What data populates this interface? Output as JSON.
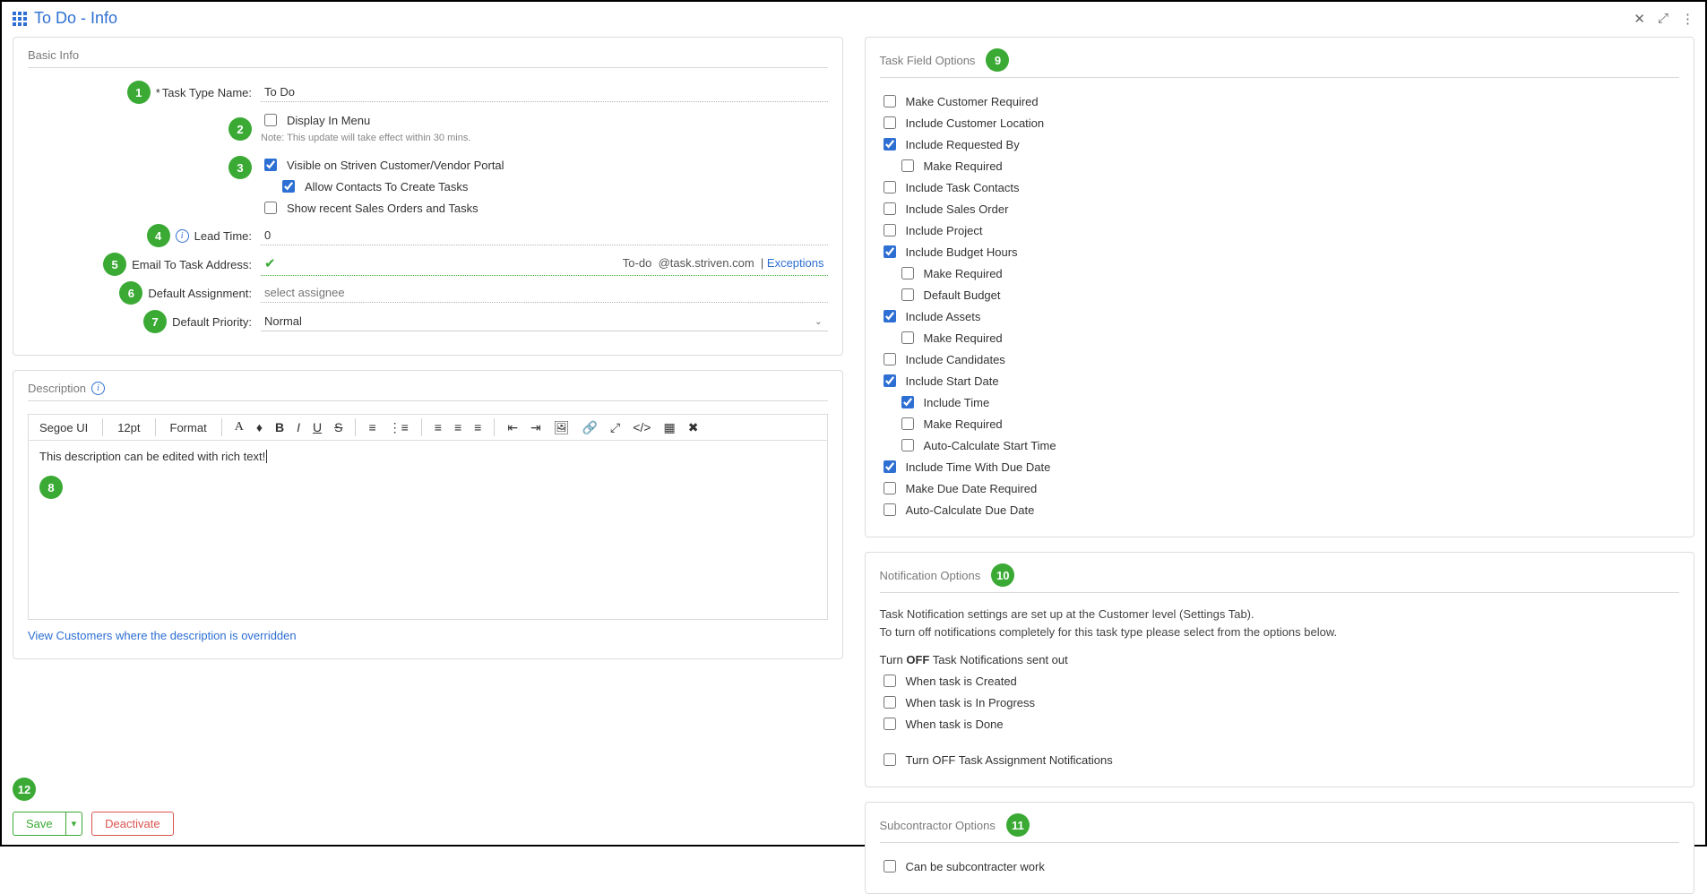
{
  "page": {
    "title": "To Do - Info"
  },
  "basic": {
    "section_title": "Basic Info",
    "task_type_label": "Task Type Name:",
    "task_type_value": "To Do",
    "display_in_menu_label": "Display In Menu",
    "display_note": "Note: This update will take effect within 30 mins.",
    "visible_portal_label": "Visible on Striven Customer/Vendor Portal",
    "allow_contacts_label": "Allow Contacts To Create Tasks",
    "show_recent_label": "Show recent Sales Orders and Tasks",
    "lead_time_label": "Lead Time:",
    "lead_time_value": "0",
    "email_task_label": "Email To Task Address:",
    "email_prefix": "To-do",
    "email_domain": "@task.striven.com",
    "exceptions_link": "Exceptions",
    "default_assignment_label": "Default Assignment:",
    "default_assignment_placeholder": "select assignee",
    "default_priority_label": "Default Priority:",
    "default_priority_value": "Normal"
  },
  "description": {
    "section_title": "Description",
    "toolbar": {
      "font": "Segoe UI",
      "size": "12pt",
      "format": "Format"
    },
    "body": "This description can be edited with rich text!",
    "overridden_link": "View Customers where the description is overridden"
  },
  "task_field_options": {
    "section_title": "Task Field Options",
    "items": [
      {
        "label": "Make Customer Required",
        "checked": false,
        "indent": 0
      },
      {
        "label": "Include Customer Location",
        "checked": false,
        "indent": 0
      },
      {
        "label": "Include Requested By",
        "checked": true,
        "indent": 0
      },
      {
        "label": "Make Required",
        "checked": false,
        "indent": 1
      },
      {
        "label": "Include Task Contacts",
        "checked": false,
        "indent": 0
      },
      {
        "label": "Include Sales Order",
        "checked": false,
        "indent": 0
      },
      {
        "label": "Include Project",
        "checked": false,
        "indent": 0
      },
      {
        "label": "Include Budget Hours",
        "checked": true,
        "indent": 0
      },
      {
        "label": "Make Required",
        "checked": false,
        "indent": 1
      },
      {
        "label": "Default Budget",
        "checked": false,
        "indent": 1
      },
      {
        "label": "Include Assets",
        "checked": true,
        "indent": 0
      },
      {
        "label": "Make Required",
        "checked": false,
        "indent": 1
      },
      {
        "label": "Include Candidates",
        "checked": false,
        "indent": 0
      },
      {
        "label": "Include Start Date",
        "checked": true,
        "indent": 0
      },
      {
        "label": "Include Time",
        "checked": true,
        "indent": 1
      },
      {
        "label": "Make Required",
        "checked": false,
        "indent": 1
      },
      {
        "label": "Auto-Calculate Start Time",
        "checked": false,
        "indent": 1
      },
      {
        "label": "Include Time With Due Date",
        "checked": true,
        "indent": 0
      },
      {
        "label": "Make Due Date Required",
        "checked": false,
        "indent": 0
      },
      {
        "label": "Auto-Calculate Due Date",
        "checked": false,
        "indent": 0
      }
    ]
  },
  "notification_options": {
    "section_title": "Notification Options",
    "desc_line1": "Task Notification settings are set up at the Customer level (Settings Tab).",
    "desc_line2": "To turn off notifications completely for this task type please select from the options below.",
    "turn_off_label_pre": "Turn ",
    "turn_off_label_bold": "OFF",
    "turn_off_label_post": " Task Notifications sent out",
    "created_label": "When task is Created",
    "in_progress_label": "When task is In Progress",
    "done_label": "When task is Done",
    "assignment_label": "Turn OFF Task Assignment Notifications"
  },
  "subcontractor_options": {
    "section_title": "Subcontractor Options",
    "can_be_label": "Can be subcontracter work"
  },
  "footer": {
    "save": "Save",
    "deactivate": "Deactivate"
  },
  "badges": {
    "b1": "1",
    "b2": "2",
    "b3": "3",
    "b4": "4",
    "b5": "5",
    "b6": "6",
    "b7": "7",
    "b8": "8",
    "b9": "9",
    "b10": "10",
    "b11": "11",
    "b12": "12"
  }
}
